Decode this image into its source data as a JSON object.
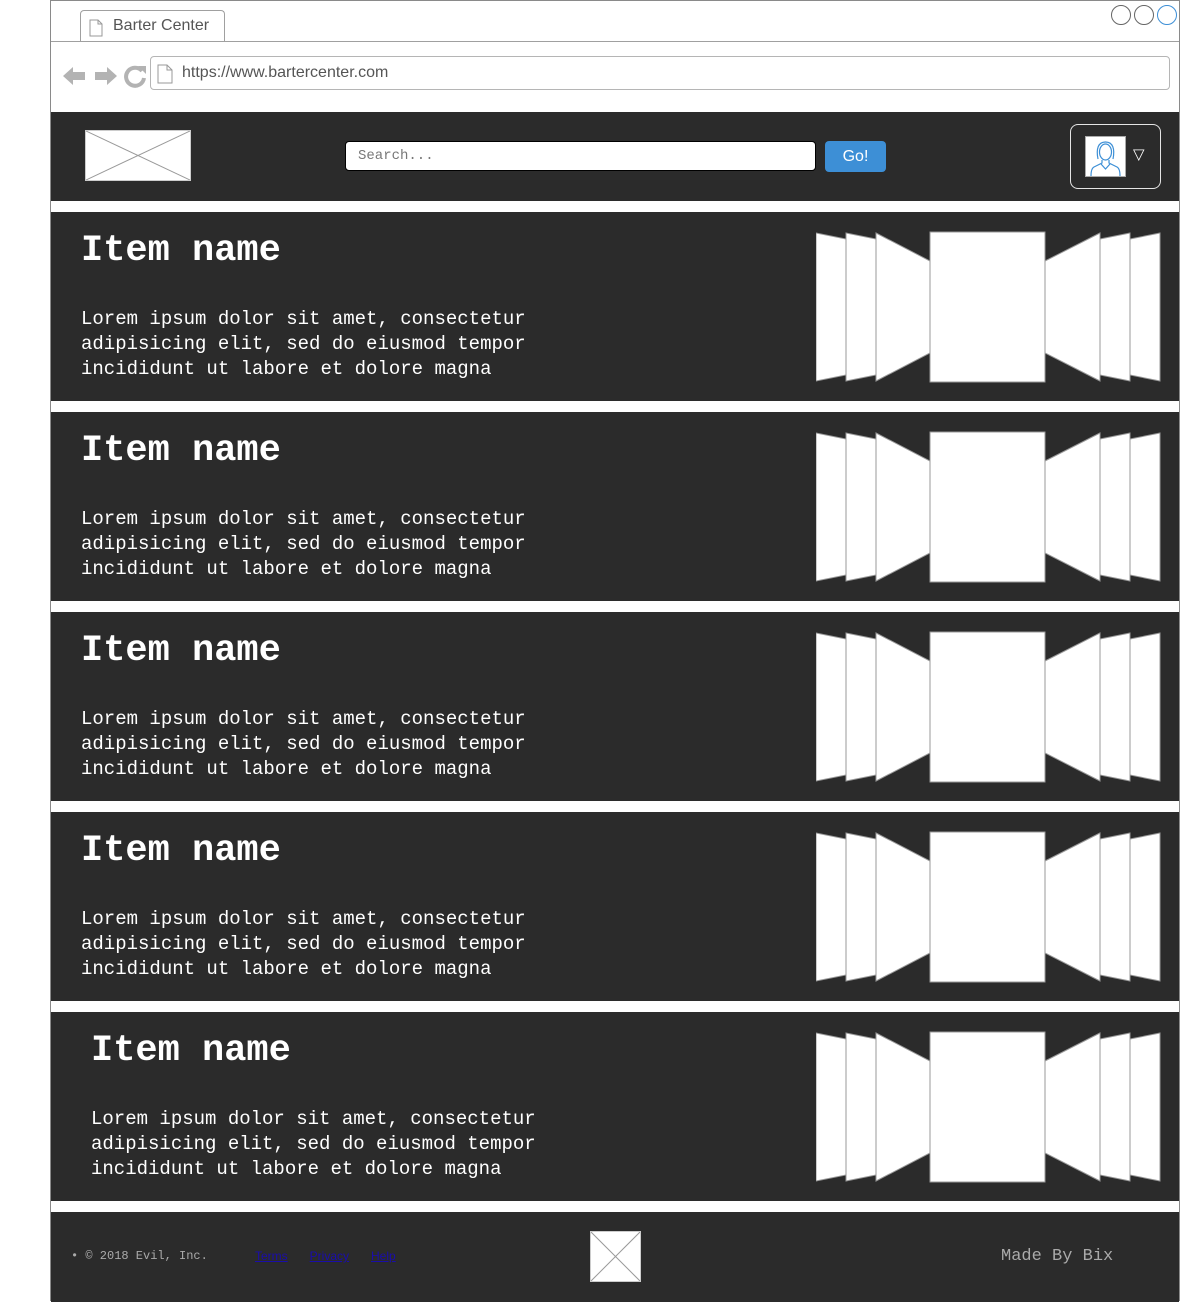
{
  "browser": {
    "tab_title": "Barter Center",
    "url": "https://www.bartercenter.com"
  },
  "header": {
    "search_placeholder": "Search...",
    "go_label": "Go!",
    "menu_caret": "▽"
  },
  "items": [
    {
      "name": "Item name",
      "description": "Lorem ipsum dolor sit amet, consectetur adipisicing elit, sed do eiusmod tempor incididunt ut labore et dolore magna"
    },
    {
      "name": "Item name",
      "description": "Lorem ipsum dolor sit amet, consectetur adipisicing elit, sed do eiusmod tempor incididunt ut labore et dolore magna"
    },
    {
      "name": "Item name",
      "description": "Lorem ipsum dolor sit amet, consectetur adipisicing elit, sed do eiusmod tempor incididunt ut labore et dolore magna"
    },
    {
      "name": "Item name",
      "description": "Lorem ipsum dolor sit amet, consectetur adipisicing elit, sed do eiusmod tempor incididunt ut labore et dolore magna"
    },
    {
      "name": "Item name",
      "description": "Lorem ipsum dolor sit amet, consectetur adipisicing elit, sed do eiusmod tempor incididunt ut labore et dolore magna"
    }
  ],
  "footer": {
    "copyright": "• © 2018 Evil, Inc.",
    "links": [
      "Terms",
      "Privacy",
      "Help"
    ],
    "made_by": "Made By Bix"
  },
  "colors": {
    "dark_panel": "#2b2b2b",
    "accent_blue": "#3d8fd6",
    "link_blue": "#1a0dab"
  }
}
